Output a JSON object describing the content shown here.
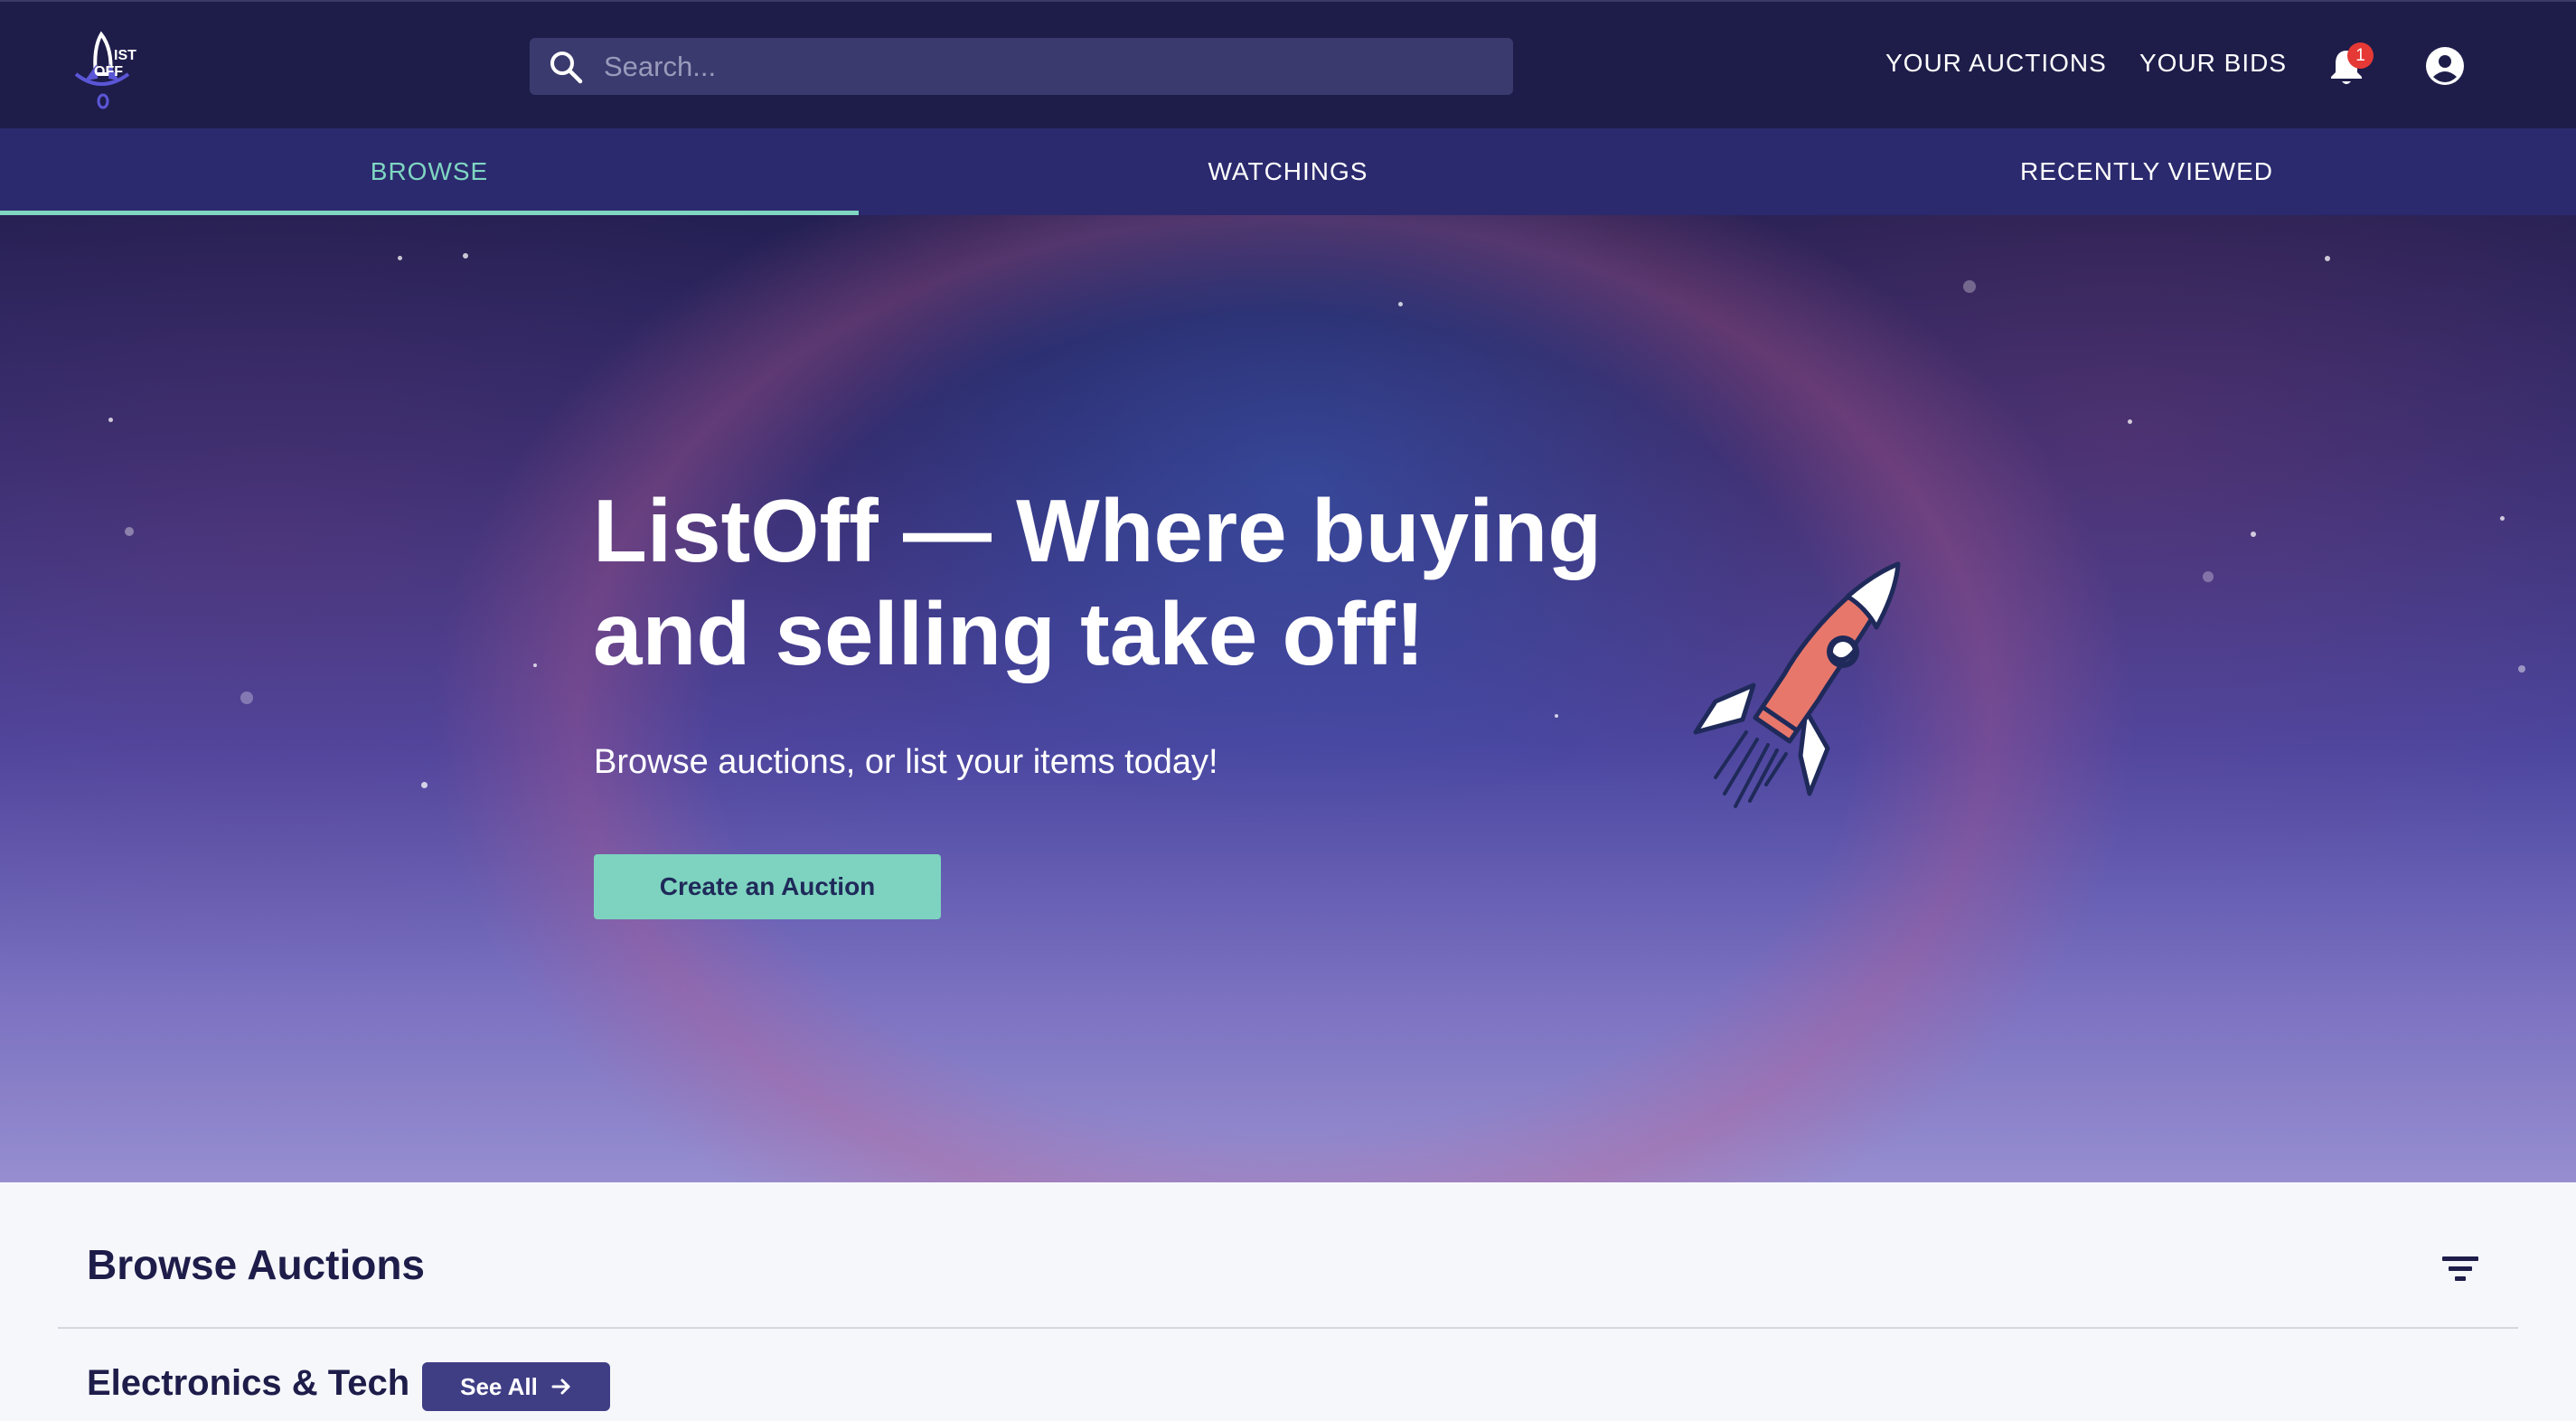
{
  "header": {
    "logo_text": "LIST OFF",
    "search_placeholder": "Search...",
    "nav": {
      "your_auctions": "YOUR AUCTIONS",
      "your_bids": "YOUR BIDS"
    },
    "notification_count": "1",
    "icons": {
      "search": "search-icon",
      "notifications": "bell-icon",
      "account": "account-circle-icon"
    }
  },
  "tabs": [
    {
      "label": "BROWSE",
      "active": true
    },
    {
      "label": "WATCHINGS",
      "active": false
    },
    {
      "label": "RECENTLY VIEWED",
      "active": false
    }
  ],
  "hero": {
    "title": "ListOff — Where buying and selling take off!",
    "subtitle": "Browse auctions, or list your items today!",
    "cta_label": "Create an Auction",
    "illustration": "rocket-icon"
  },
  "browse": {
    "title": "Browse Auctions",
    "filter_icon": "filter-icon",
    "category": {
      "title": "Electronics & Tech",
      "see_all_label": "See All"
    }
  },
  "colors": {
    "header_bg": "#1e1d4a",
    "tabs_bg": "#2b2a6e",
    "accent": "#7fd6c2",
    "badge": "#e53935",
    "cta_bg": "#7dd3bf",
    "see_all_bg": "#3f3e85"
  }
}
